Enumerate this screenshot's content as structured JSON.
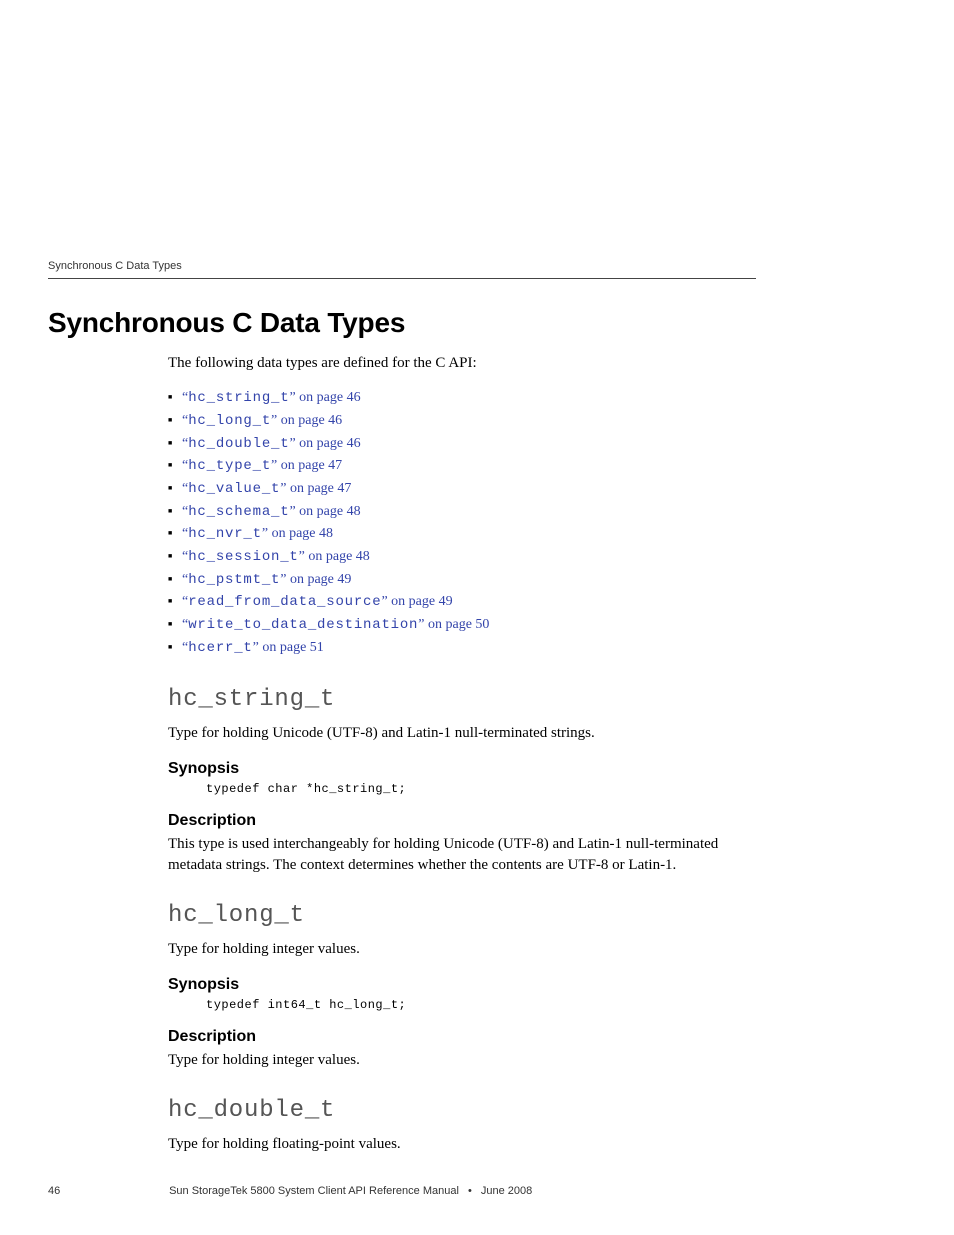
{
  "header": {
    "running": "Synchronous C Data Types"
  },
  "title": "Synchronous C Data Types",
  "intro": "The following data types are defined for the C API:",
  "links": [
    {
      "code": "hc_string_t",
      "tail": " on page 46"
    },
    {
      "code": "hc_long_t",
      "tail": " on page 46"
    },
    {
      "code": "hc_double_t",
      "tail": " on page 46"
    },
    {
      "code": "hc_type_t",
      "tail": " on page 47"
    },
    {
      "code": "hc_value_t",
      "tail": " on page 47"
    },
    {
      "code": "hc_schema_t",
      "tail": " on page 48"
    },
    {
      "code": "hc_nvr_t",
      "tail": " on page 48"
    },
    {
      "code": "hc_session_t",
      "tail": " on page 48"
    },
    {
      "code": "hc_pstmt_t",
      "tail": " on page 49"
    },
    {
      "code": "read_from_data_source",
      "tail": " on page 49"
    },
    {
      "code": "write_to_data_destination",
      "tail": " on page 50"
    },
    {
      "code": "hcerr_t",
      "tail": " on page 51"
    }
  ],
  "quote_open": "“",
  "quote_close": "”",
  "labels": {
    "synopsis": "Synopsis",
    "description": "Description"
  },
  "sections": {
    "string": {
      "head": "hc_string_t",
      "summary": "Type for holding Unicode (UTF-8) and Latin-1 null-terminated strings.",
      "code": "typedef char *hc_string_t;",
      "desc": "This type is used interchangeably for holding Unicode (UTF-8) and Latin-1 null-terminated metadata strings. The context determines whether the contents are UTF-8 or Latin-1."
    },
    "long": {
      "head": "hc_long_t",
      "summary": "Type for holding integer values.",
      "code": "typedef int64_t hc_long_t;",
      "desc": "Type for holding integer values."
    },
    "double": {
      "head": "hc_double_t",
      "summary": "Type for holding floating-point values."
    }
  },
  "footer": {
    "page": "46",
    "doc": "Sun StorageTek 5800 System Client API Reference Manual",
    "sep": "•",
    "date": "June 2008"
  }
}
